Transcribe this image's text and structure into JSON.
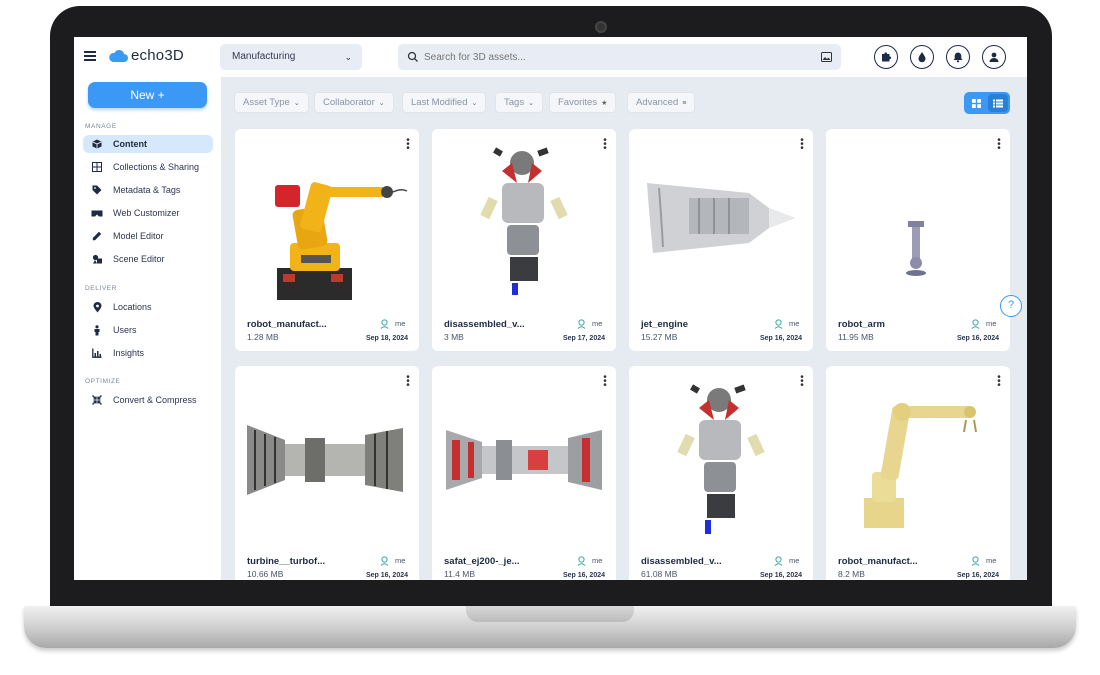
{
  "app": {
    "logo_text": "echo3D"
  },
  "header": {
    "workspace": "Manufacturing",
    "search_placeholder": "Search for 3D assets...",
    "icons": [
      "puzzle-icon",
      "drop-icon",
      "bell-icon",
      "user-icon"
    ]
  },
  "sidebar": {
    "new_button": "New +",
    "sections": [
      {
        "label": "MANAGE",
        "items": [
          {
            "label": "Content",
            "icon": "cube-icon",
            "active": true
          },
          {
            "label": "Collections & Sharing",
            "icon": "grid-icon"
          },
          {
            "label": "Metadata & Tags",
            "icon": "tag-icon"
          },
          {
            "label": "Web Customizer",
            "icon": "vr-headset-icon"
          },
          {
            "label": "Model Editor",
            "icon": "pencil-icon"
          },
          {
            "label": "Scene Editor",
            "icon": "shapes-icon"
          }
        ]
      },
      {
        "label": "DELIVER",
        "items": [
          {
            "label": "Locations",
            "icon": "pin-icon"
          },
          {
            "label": "Users",
            "icon": "person-icon"
          },
          {
            "label": "Insights",
            "icon": "chart-icon"
          }
        ]
      },
      {
        "label": "OPTIMIZE",
        "items": [
          {
            "label": "Convert & Compress",
            "icon": "compress-icon"
          }
        ]
      }
    ]
  },
  "filters": [
    {
      "label": "Asset Type",
      "icon": "chevron"
    },
    {
      "label": "Collaborator",
      "icon": "chevron"
    },
    {
      "label": "Last Modified",
      "icon": "chevron"
    },
    {
      "label": "Tags",
      "icon": "chevron"
    },
    {
      "label": "Favorites",
      "icon": "star"
    },
    {
      "label": "Advanced",
      "icon": "sliders"
    }
  ],
  "view_modes": [
    "grid-view",
    "list-view"
  ],
  "colors": {
    "accent": "#3b99f5",
    "navy": "#1f2a44",
    "robot_yellow": "#f2b319",
    "robot_cream": "#e8d690"
  },
  "assets": [
    {
      "name": "robot_manufact...",
      "size": "1.28 MB",
      "owner": "me",
      "date": "Sep 18, 2024",
      "thumb": "yellow-robot"
    },
    {
      "name": "disassembled_v...",
      "size": "3 MB",
      "owner": "me",
      "date": "Sep 17, 2024",
      "thumb": "engine-exploded"
    },
    {
      "name": "jet_engine",
      "size": "15.27 MB",
      "owner": "me",
      "date": "Sep 16, 2024",
      "thumb": "jet-engine"
    },
    {
      "name": "robot_arm",
      "size": "11.95 MB",
      "owner": "me",
      "date": "Sep 16, 2024",
      "thumb": "small-arm"
    },
    {
      "name": "turbine__turbof...",
      "size": "10.66 MB",
      "owner": "me",
      "date": "Sep 16, 2024",
      "thumb": "turbofan"
    },
    {
      "name": "safat_ej200-_je...",
      "size": "11.4 MB",
      "owner": "me",
      "date": "Sep 16, 2024",
      "thumb": "turbofan-red"
    },
    {
      "name": "disassembled_v...",
      "size": "61.08 MB",
      "owner": "me",
      "date": "Sep 16, 2024",
      "thumb": "engine-exploded"
    },
    {
      "name": "robot_manufact...",
      "size": "8.2 MB",
      "owner": "me",
      "date": "Sep 16, 2024",
      "thumb": "cream-robot"
    }
  ],
  "help_label": "?"
}
